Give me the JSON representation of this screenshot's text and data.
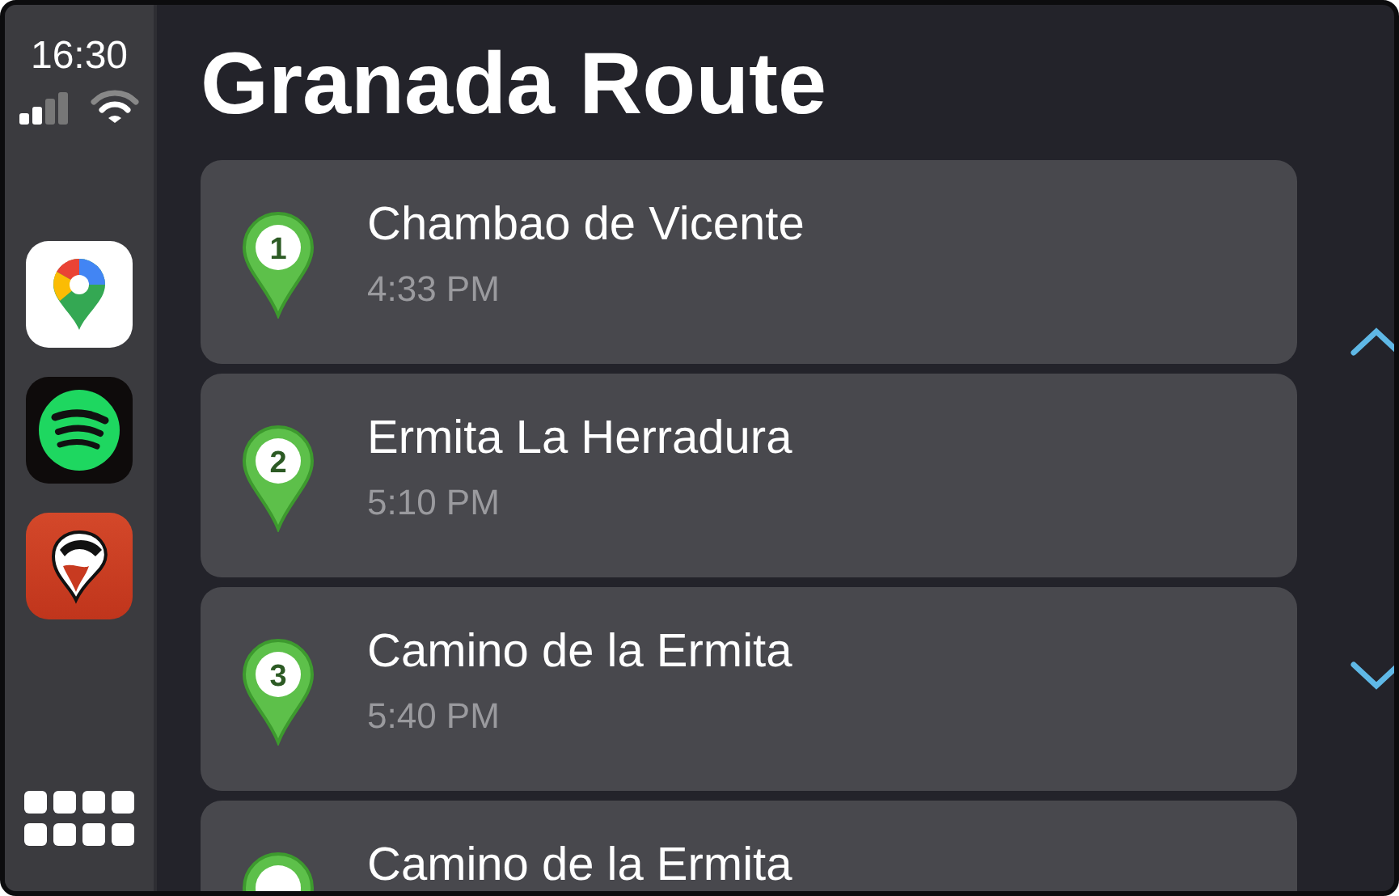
{
  "status": {
    "time": "16:30"
  },
  "dock": {
    "apps": [
      {
        "kind": "maps"
      },
      {
        "kind": "music"
      },
      {
        "kind": "badger"
      }
    ]
  },
  "title": "Granada Route",
  "stops": [
    {
      "number": "1",
      "name": "Chambao de Vicente",
      "time": "4:33 PM"
    },
    {
      "number": "2",
      "name": "Ermita La Herradura",
      "time": "5:10 PM"
    },
    {
      "number": "3",
      "name": "Camino de la Ermita",
      "time": "5:40 PM"
    },
    {
      "name": "Camino de la Ermita"
    }
  ]
}
